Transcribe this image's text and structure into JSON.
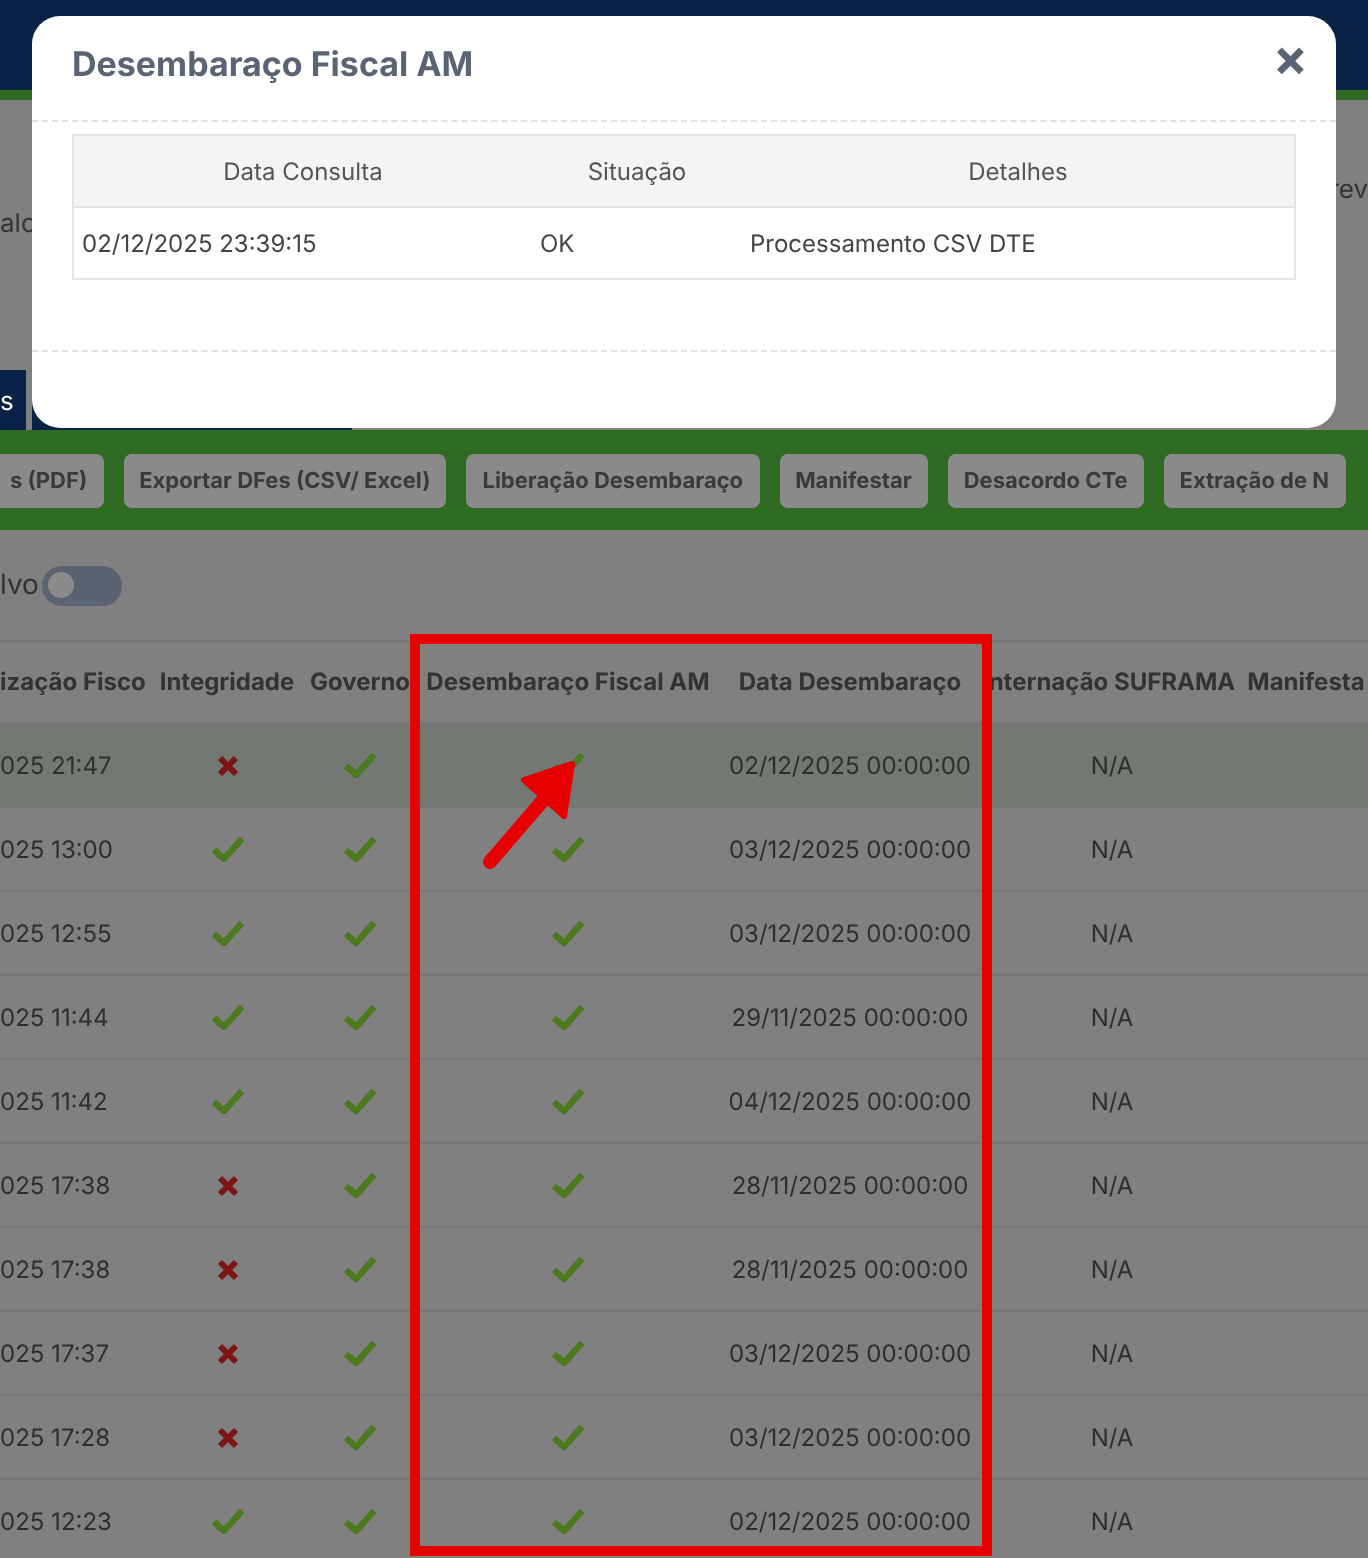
{
  "background": {
    "left_label": "alo",
    "right_label": "rev",
    "tab_label": "s",
    "toolbar": [
      "s (PDF)",
      "Exportar DFes (CSV/ Excel)",
      "Liberação Desembaraço",
      "Manifestar",
      "Desacordo CTe",
      "Extração de N"
    ],
    "toggle": {
      "label": "lvo",
      "on": false
    },
    "table": {
      "columns": [
        "ização Fisco",
        "Integridade",
        "Governo",
        "Desembaraço Fiscal AM",
        "Data Desembaraço",
        "nternação SUFRAMA",
        "Manifesta"
      ],
      "rows": [
        {
          "selected": true,
          "time": "025 21:47",
          "integridade": false,
          "governo": true,
          "desembaraco": true,
          "data": "02/12/2025 00:00:00",
          "suframa": "N/A"
        },
        {
          "selected": false,
          "time": "025 13:00",
          "integridade": true,
          "governo": true,
          "desembaraco": true,
          "data": "03/12/2025 00:00:00",
          "suframa": "N/A"
        },
        {
          "selected": false,
          "time": "025 12:55",
          "integridade": true,
          "governo": true,
          "desembaraco": true,
          "data": "03/12/2025 00:00:00",
          "suframa": "N/A"
        },
        {
          "selected": false,
          "time": "025 11:44",
          "integridade": true,
          "governo": true,
          "desembaraco": true,
          "data": "29/11/2025 00:00:00",
          "suframa": "N/A"
        },
        {
          "selected": false,
          "time": "025 11:42",
          "integridade": true,
          "governo": true,
          "desembaraco": true,
          "data": "04/12/2025 00:00:00",
          "suframa": "N/A"
        },
        {
          "selected": false,
          "time": "025 17:38",
          "integridade": false,
          "governo": true,
          "desembaraco": true,
          "data": "28/11/2025 00:00:00",
          "suframa": "N/A"
        },
        {
          "selected": false,
          "time": "025 17:38",
          "integridade": false,
          "governo": true,
          "desembaraco": true,
          "data": "28/11/2025 00:00:00",
          "suframa": "N/A"
        },
        {
          "selected": false,
          "time": "025 17:37",
          "integridade": false,
          "governo": true,
          "desembaraco": true,
          "data": "03/12/2025 00:00:00",
          "suframa": "N/A"
        },
        {
          "selected": false,
          "time": "025 17:28",
          "integridade": false,
          "governo": true,
          "desembaraco": true,
          "data": "03/12/2025 00:00:00",
          "suframa": "N/A"
        },
        {
          "selected": false,
          "time": "025 12:23",
          "integridade": true,
          "governo": true,
          "desembaraco": true,
          "data": "02/12/2025 00:00:00",
          "suframa": "N/A"
        }
      ]
    }
  },
  "modal": {
    "title": "Desembaraço Fiscal AM",
    "close": "×",
    "columns": [
      "Data Consulta",
      "Situação",
      "Detalhes"
    ],
    "rows": [
      {
        "data": "02/12/2025 23:39:15",
        "situacao": "OK",
        "detalhes": "Processamento CSV DTE"
      }
    ]
  }
}
